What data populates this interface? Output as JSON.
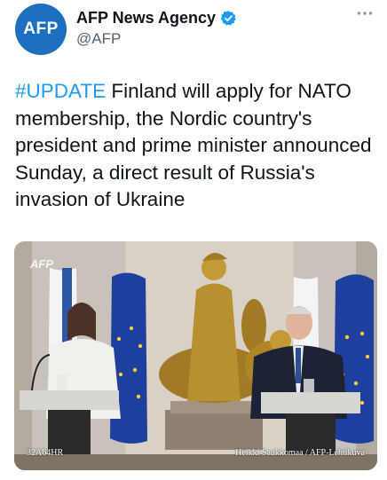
{
  "account": {
    "avatar_text": "AFP",
    "display_name": "AFP News Agency",
    "handle": "@AFP",
    "verified_icon": "verified-badge-icon",
    "more_icon": "more-options-icon"
  },
  "tweet": {
    "hashtag": "#UPDATE",
    "text": " Finland will apply for NATO membership, the Nordic country's president and prime minister announced Sunday, a direct result of Russia's invasion of Ukraine"
  },
  "photo": {
    "logo_text": "AFP",
    "image_id": "32A64HR",
    "credit": "Heikki Saukkomaa / AFP-Lehtikuva"
  },
  "colors": {
    "link": "#1d9bf0",
    "avatar_bg": "#1d6fbf",
    "eu_blue": "#1f3f9e",
    "eu_star": "#f5d033",
    "statue_gold": "#b8902f"
  }
}
